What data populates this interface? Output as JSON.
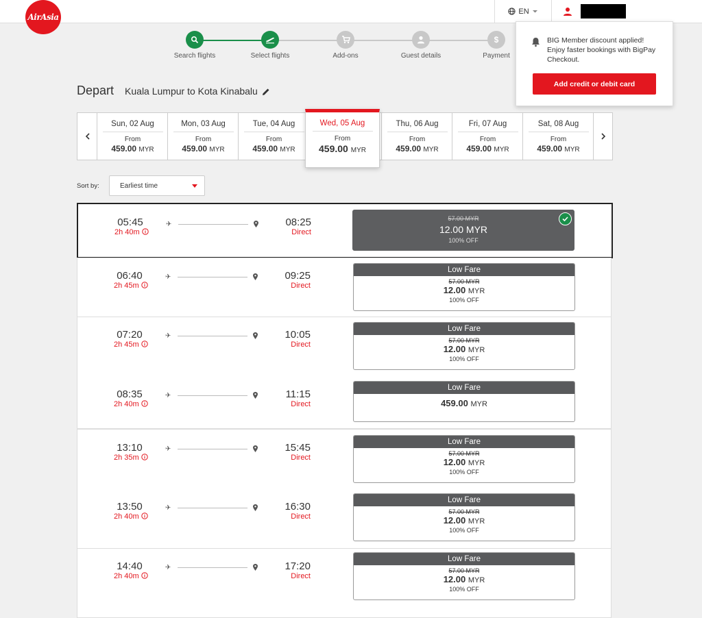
{
  "header": {
    "logo_text": "AirAsia",
    "language": "EN"
  },
  "steps": [
    {
      "label": "Search flights",
      "state": "done",
      "icon": "search-icon"
    },
    {
      "label": "Select flights",
      "state": "current",
      "icon": "plane-takeoff-icon"
    },
    {
      "label": "Add-ons",
      "state": "pending",
      "icon": "cart-icon"
    },
    {
      "label": "Guest details",
      "state": "pending",
      "icon": "person-icon"
    },
    {
      "label": "Payment",
      "state": "pending",
      "icon": "dollar-icon"
    }
  ],
  "popup": {
    "message": "BIG Member discount applied! Enjoy faster bookings with BigPay Checkout.",
    "button": "Add credit or debit card"
  },
  "depart": {
    "label": "Depart",
    "route": "Kuala Lumpur to Kota Kinabalu"
  },
  "dates": [
    {
      "day": "Sun, 02 Aug",
      "from": "From",
      "price": "459.00",
      "currency": "MYR"
    },
    {
      "day": "Mon, 03 Aug",
      "from": "From",
      "price": "459.00",
      "currency": "MYR"
    },
    {
      "day": "Tue, 04 Aug",
      "from": "From",
      "price": "459.00",
      "currency": "MYR"
    },
    {
      "day": "Wed, 05 Aug",
      "from": "From",
      "price": "459.00",
      "currency": "MYR"
    },
    {
      "day": "Thu, 06 Aug",
      "from": "From",
      "price": "459.00",
      "currency": "MYR"
    },
    {
      "day": "Fri, 07 Aug",
      "from": "From",
      "price": "459.00",
      "currency": "MYR"
    },
    {
      "day": "Sat, 08 Aug",
      "from": "From",
      "price": "459.00",
      "currency": "MYR"
    }
  ],
  "sort": {
    "label": "Sort by:",
    "value": "Earliest time"
  },
  "flights": [
    {
      "dep": "05:45",
      "dur": "2h 40m",
      "arr": "08:25",
      "type": "Direct",
      "fare_label": "",
      "old": "57.00 MYR",
      "price": "12.00",
      "currency": "MYR",
      "off": "100% OFF"
    },
    {
      "dep": "06:40",
      "dur": "2h 45m",
      "arr": "09:25",
      "type": "Direct",
      "fare_label": "Low Fare",
      "old": "57.00 MYR",
      "price": "12.00",
      "currency": "MYR",
      "off": "100% OFF"
    },
    {
      "dep": "07:20",
      "dur": "2h 45m",
      "arr": "10:05",
      "type": "Direct",
      "fare_label": "Low Fare",
      "old": "57.00 MYR",
      "price": "12.00",
      "currency": "MYR",
      "off": "100% OFF"
    },
    {
      "dep": "08:35",
      "dur": "2h 40m",
      "arr": "11:15",
      "type": "Direct",
      "fare_label": "Low Fare",
      "old": "",
      "price": "459.00",
      "currency": "MYR",
      "off": ""
    },
    {
      "dep": "13:10",
      "dur": "2h 35m",
      "arr": "15:45",
      "type": "Direct",
      "fare_label": "Low Fare",
      "old": "57.00 MYR",
      "price": "12.00",
      "currency": "MYR",
      "off": "100% OFF"
    },
    {
      "dep": "13:50",
      "dur": "2h 40m",
      "arr": "16:30",
      "type": "Direct",
      "fare_label": "Low Fare",
      "old": "57.00 MYR",
      "price": "12.00",
      "currency": "MYR",
      "off": "100% OFF"
    },
    {
      "dep": "14:40",
      "dur": "2h 40m",
      "arr": "17:20",
      "type": "Direct",
      "fare_label": "Low Fare",
      "old": "57.00 MYR",
      "price": "12.00",
      "currency": "MYR",
      "off": "100% OFF"
    }
  ],
  "colors": {
    "brand": "#e3171f",
    "step_done": "#1a8f4a",
    "step_pending": "#c8c8c8",
    "fare_header": "#595a5c"
  }
}
